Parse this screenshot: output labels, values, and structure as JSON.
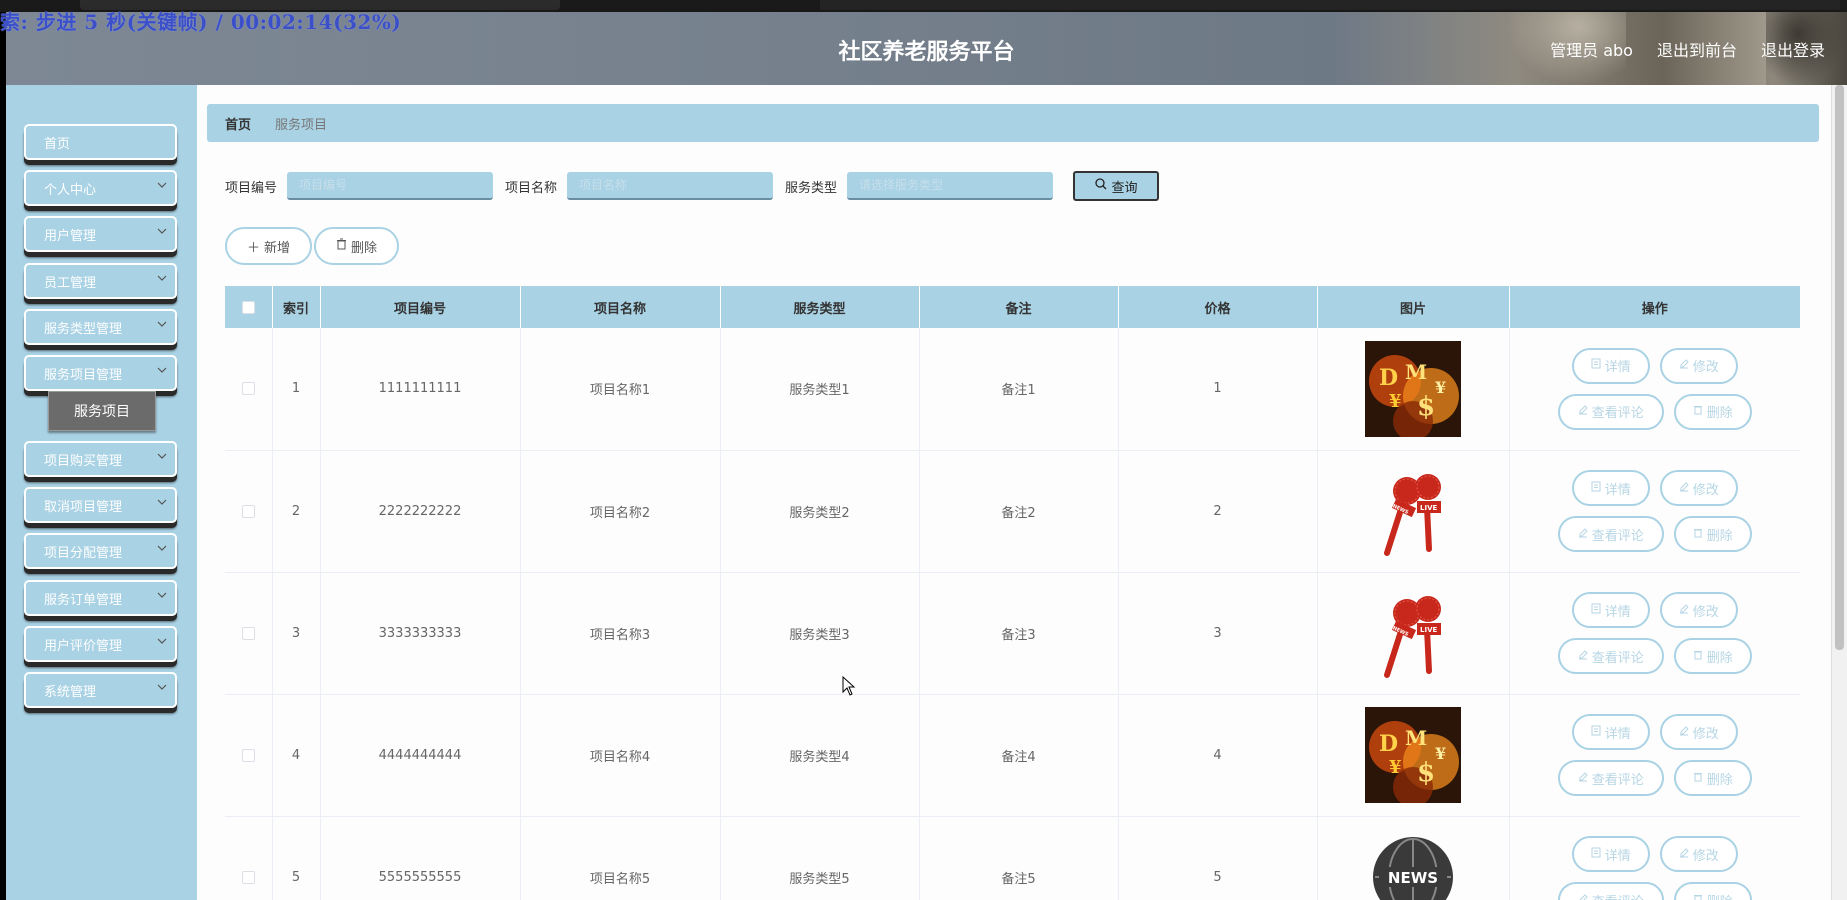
{
  "overlay_text": "索: 步进 5 秒(关键帧) / 00:02:14(32%)",
  "header": {
    "title": "社区养老服务平台",
    "user_label": "管理员 abo",
    "to_front": "退出到前台",
    "logout": "退出登录"
  },
  "sidebar": {
    "items": [
      {
        "label": "首页",
        "has_chevron": false
      },
      {
        "label": "个人中心",
        "has_chevron": true
      },
      {
        "label": "用户管理",
        "has_chevron": true
      },
      {
        "label": "员工管理",
        "has_chevron": true
      },
      {
        "label": "服务类型管理",
        "has_chevron": true
      },
      {
        "label": "服务项目管理",
        "has_chevron": true
      },
      {
        "label": "项目购买管理",
        "has_chevron": true
      },
      {
        "label": "取消项目管理",
        "has_chevron": true
      },
      {
        "label": "项目分配管理",
        "has_chevron": true
      },
      {
        "label": "服务订单管理",
        "has_chevron": true
      },
      {
        "label": "用户评价管理",
        "has_chevron": true
      },
      {
        "label": "系统管理",
        "has_chevron": true
      }
    ],
    "submenu": {
      "label": "服务项目"
    }
  },
  "breadcrumb": {
    "home": "首页",
    "current": "服务项目"
  },
  "search": {
    "code_label": "项目编号",
    "code_placeholder": "项目编号",
    "name_label": "项目名称",
    "name_placeholder": "项目名称",
    "type_label": "服务类型",
    "type_placeholder": "请选择服务类型",
    "button": "查询"
  },
  "actions": {
    "add": "新增",
    "delete": "删除"
  },
  "table": {
    "headers": [
      "索引",
      "项目编号",
      "项目名称",
      "服务类型",
      "备注",
      "价格",
      "图片",
      "操作"
    ],
    "ops": {
      "detail": "详情",
      "edit": "修改",
      "comments": "查看评论",
      "delete": "删除"
    },
    "rows": [
      {
        "index": "1",
        "code": "1111111111",
        "name": "项目名称1",
        "type": "服务类型1",
        "note": "备注1",
        "price": "1",
        "image": "money-poster"
      },
      {
        "index": "2",
        "code": "2222222222",
        "name": "项目名称2",
        "type": "服务类型2",
        "note": "备注2",
        "price": "2",
        "image": "news-microphones"
      },
      {
        "index": "3",
        "code": "3333333333",
        "name": "项目名称3",
        "type": "服务类型3",
        "note": "备注3",
        "price": "3",
        "image": "news-microphones"
      },
      {
        "index": "4",
        "code": "4444444444",
        "name": "项目名称4",
        "type": "服务类型4",
        "note": "备注4",
        "price": "4",
        "image": "money-poster"
      },
      {
        "index": "5",
        "code": "5555555555",
        "name": "项目名称5",
        "type": "服务类型5",
        "note": "备注5",
        "price": "5",
        "image": "news-globe-badge"
      }
    ]
  },
  "colors": {
    "accent": "#a9d2e4",
    "header_bg": "#76818d",
    "submenu_bg": "#6b6b6b"
  }
}
